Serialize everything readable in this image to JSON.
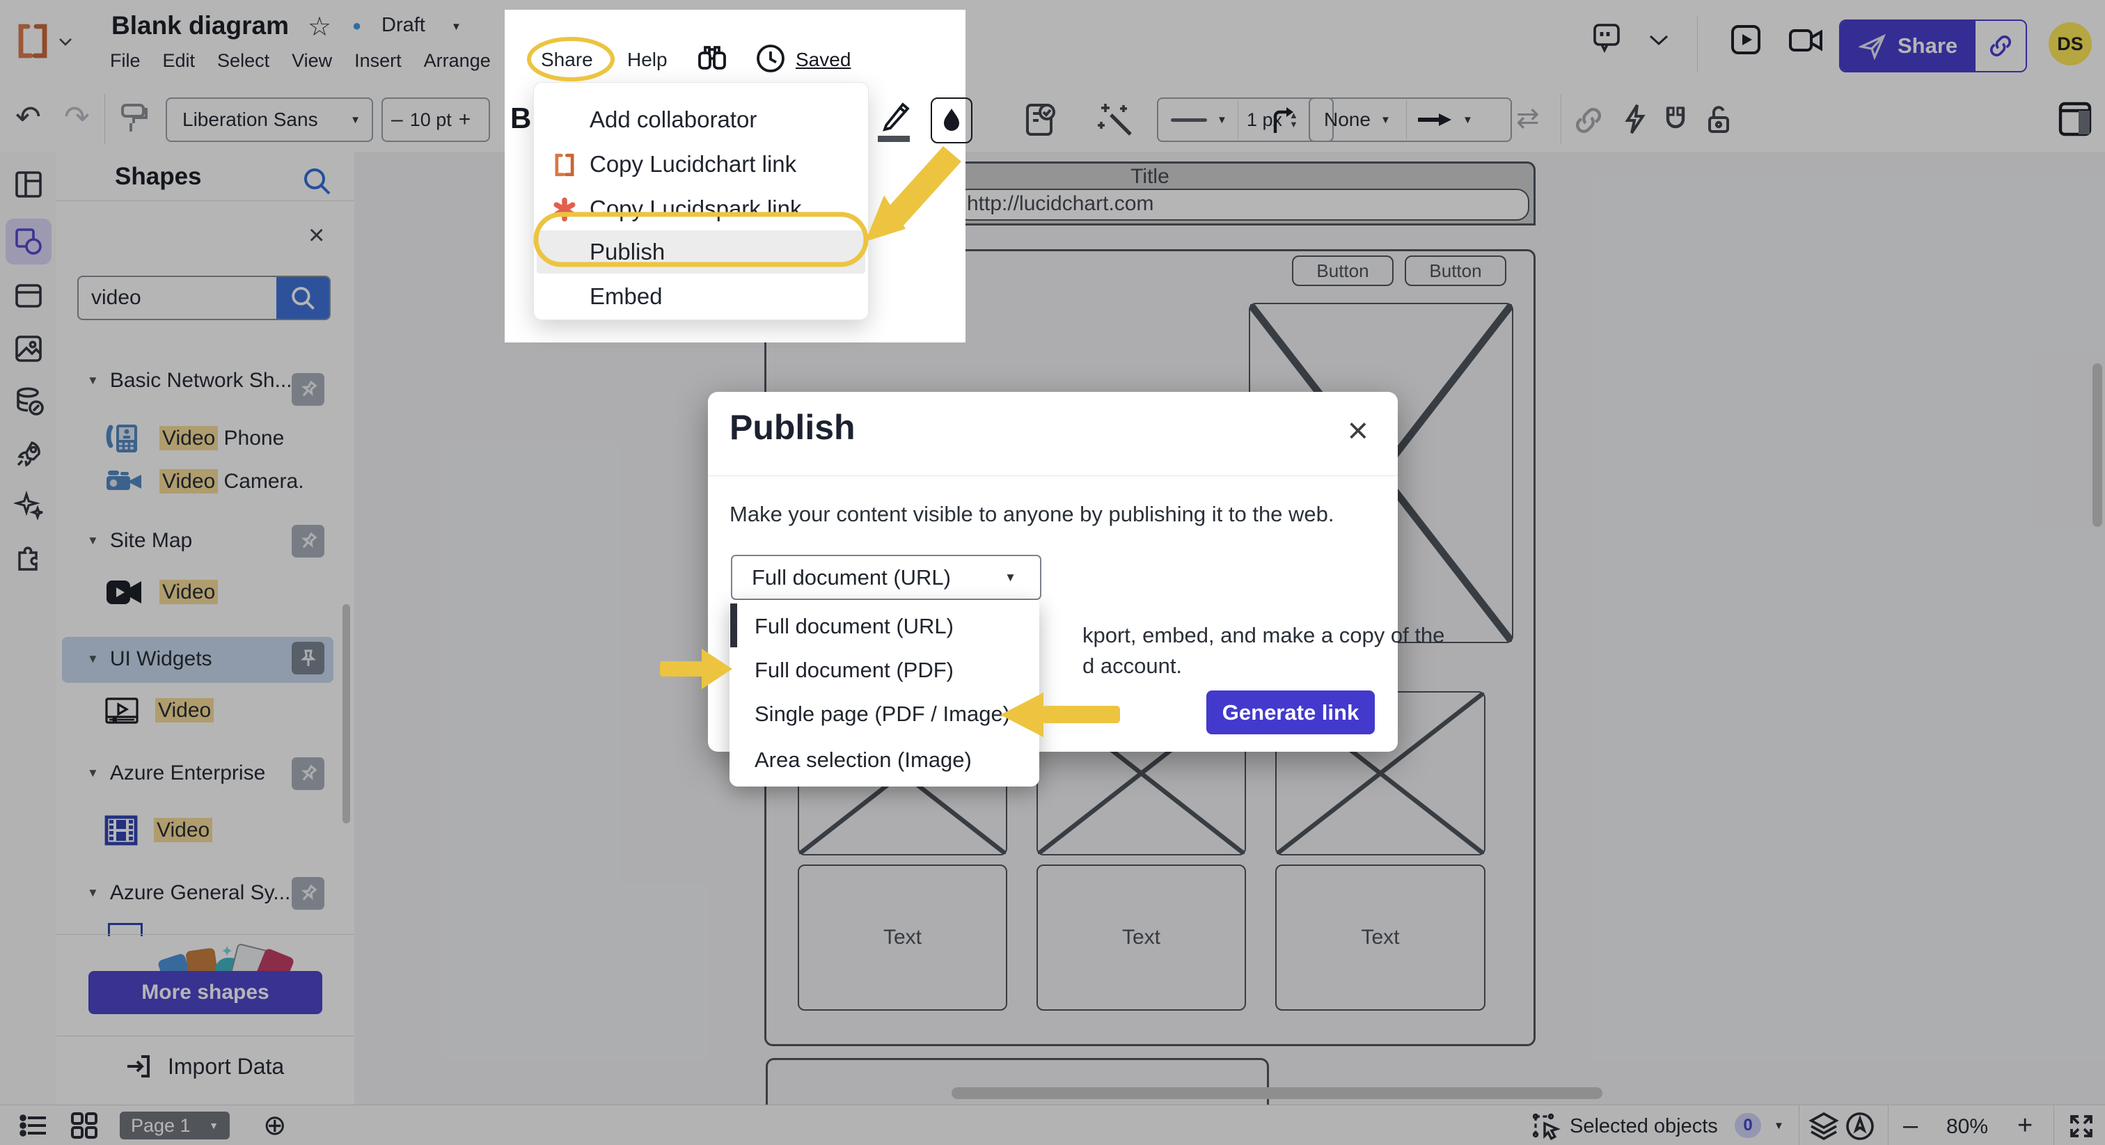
{
  "header": {
    "doc_title": "Blank diagram",
    "status_label": "Draft",
    "menus": [
      "File",
      "Edit",
      "Select",
      "View",
      "Insert",
      "Arrange",
      "Share",
      "Help"
    ],
    "saved_label": "Saved",
    "share_button_label": "Share",
    "avatar_initials": "DS"
  },
  "toolbar": {
    "font_family": "Liberation Sans",
    "size_minus": "–",
    "font_size": "10 pt",
    "size_plus": "+",
    "bold_label": "B",
    "stroke_width": "1 px",
    "fill_value": "None"
  },
  "share_menu": {
    "items": [
      {
        "label": "Add collaborator"
      },
      {
        "label": "Copy Lucidchart link",
        "icon": "lucidchart-logo"
      },
      {
        "label": "Copy Lucidspark link",
        "icon": "lucidspark-logo"
      },
      {
        "label": "Publish",
        "highlighted": true
      },
      {
        "label": "Embed"
      }
    ]
  },
  "publish_dialog": {
    "title": "Publish",
    "close_glyph": "×",
    "description": "Make your content visible to anyone by publishing it to the web.",
    "select_value": "Full document (URL)",
    "options": [
      {
        "label": "Full document (URL)",
        "selected": true
      },
      {
        "label": "Full document (PDF)"
      },
      {
        "label": "Single page (PDF / Image)"
      },
      {
        "label": "Area selection (Image)"
      }
    ],
    "occluded_text_line1": "kport, embed, and make a copy of the",
    "occluded_text_line2": "d account.",
    "generate_button": "Generate link"
  },
  "sidebar": {
    "panel_title": "Shapes",
    "search_value": "video",
    "sections": [
      {
        "label": "Basic Network Sh..."
      },
      {
        "label": "Site Map"
      },
      {
        "label": "UI Widgets",
        "selected": true
      },
      {
        "label": "Azure Enterprise"
      },
      {
        "label": "Azure General Sy..."
      }
    ],
    "items": [
      {
        "hl": "Video",
        "rest": " Phone"
      },
      {
        "hl": "Video",
        "rest": " Camera."
      },
      {
        "hl": "Video",
        "rest": ""
      },
      {
        "hl": "Video",
        "rest": ""
      },
      {
        "hl": "Video",
        "rest": ""
      }
    ],
    "more_shapes_button": "More shapes",
    "import_data_label": "Import Data"
  },
  "canvas_wireframe": {
    "title": "Title",
    "url": "http://lucidchart.com",
    "buttons": [
      "Button",
      "Button"
    ],
    "text_boxes": [
      "Text",
      "Text",
      "Text"
    ]
  },
  "statusbar": {
    "page_label": "Page 1",
    "selected_label": "Selected objects",
    "selected_count": "0",
    "zoom_value": "80%"
  },
  "colors": {
    "accent": "#4339CD",
    "search_blue": "#3A6FD8",
    "annotation_yellow": "#ECC440",
    "match_highlight": "#F7DC96",
    "avatar_bg": "#FFE952",
    "draft_dot": "#3E96E0"
  }
}
